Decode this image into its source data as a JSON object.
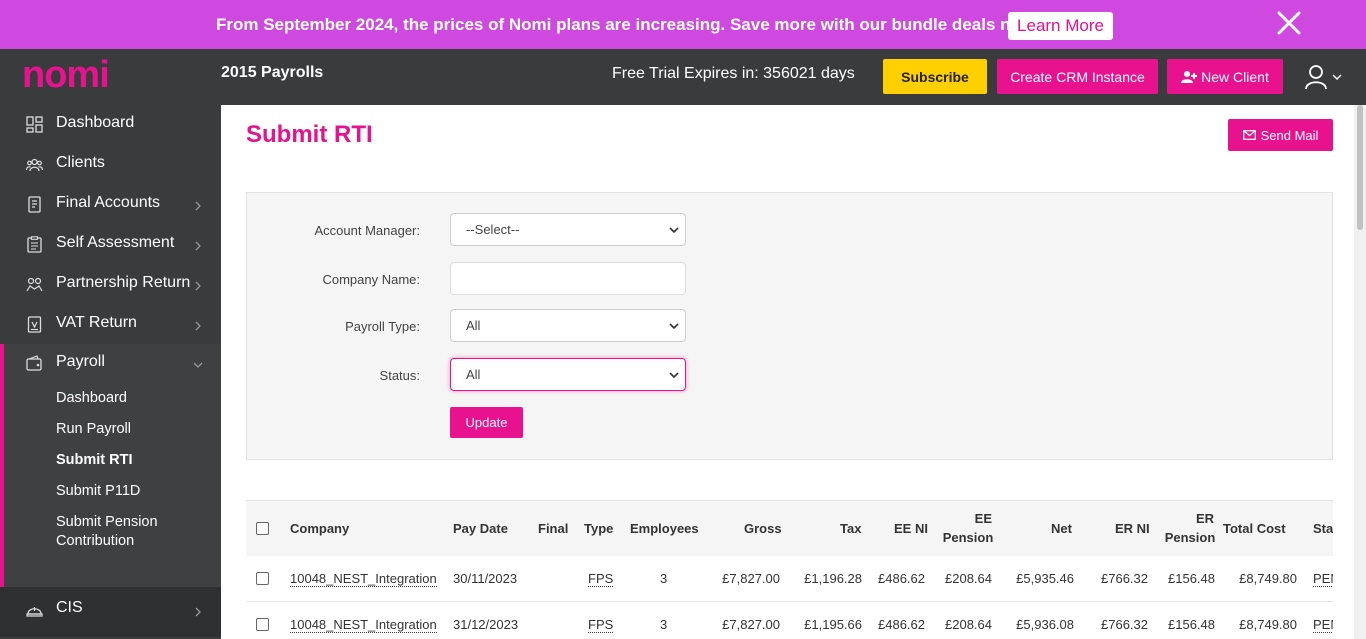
{
  "promo": {
    "text": "From September 2024, the prices of Nomi plans are increasing. Save more with our bundle deals now!",
    "button": "Learn More"
  },
  "header": {
    "logo_text": "nomi",
    "title": "2015 Payrolls",
    "trial": "Free Trial Expires in: 356021 days",
    "subscribe": "Subscribe",
    "crm": "Create CRM Instance",
    "new_client": "New Client"
  },
  "sidebar": {
    "items": [
      {
        "label": "Dashboard",
        "icon": "dashboard-icon"
      },
      {
        "label": "Clients",
        "icon": "clients-icon"
      },
      {
        "label": "Final Accounts",
        "icon": "document-icon"
      },
      {
        "label": "Self Assessment",
        "icon": "clipboard-icon"
      },
      {
        "label": "Partnership Return",
        "icon": "partnership-icon"
      },
      {
        "label": "VAT Return",
        "icon": "vat-icon"
      },
      {
        "label": "Payroll",
        "icon": "wallet-icon"
      }
    ],
    "payroll_sub": [
      "Dashboard",
      "Run Payroll",
      "Submit RTI",
      "Submit P11D",
      "Submit Pension",
      "Contribution"
    ],
    "cis": "CIS"
  },
  "main": {
    "title": "Submit RTI",
    "send_mail": "Send Mail"
  },
  "filters": {
    "account_manager_label": "Account Manager:",
    "account_manager_value": "--Select--",
    "company_name_label": "Company Name:",
    "company_name_value": "",
    "payroll_type_label": "Payroll Type:",
    "payroll_type_value": "All",
    "status_label": "Status:",
    "status_value": "All",
    "update": "Update"
  },
  "table": {
    "headers": {
      "company": "Company",
      "pay_date": "Pay Date",
      "final": "Final",
      "type": "Type",
      "employees": "Employees",
      "gross": "Gross",
      "tax": "Tax",
      "ee_ni": "EE NI",
      "ee_pension_1": "EE",
      "ee_pension_2": "Pension",
      "net": "Net",
      "er_ni": "ER NI",
      "er_pension_1": "ER",
      "er_pension_2": "Pension",
      "total_cost": "Total Cost",
      "status": "Sta"
    },
    "rows": [
      {
        "company": "10048_NEST_Integration",
        "pay_date": "30/11/2023",
        "final": "",
        "type": "FPS",
        "employees": "3",
        "gross": "£7,827.00",
        "tax": "£1,196.28",
        "ee_ni": "£486.62",
        "ee_pension": "£208.64",
        "net": "£5,935.46",
        "er_ni": "£766.32",
        "er_pension": "£156.48",
        "total_cost": "£8,749.80",
        "status": "PEN"
      },
      {
        "company": "10048_NEST_Integration",
        "pay_date": "31/12/2023",
        "final": "",
        "type": "FPS",
        "employees": "3",
        "gross": "£7,827.00",
        "tax": "£1,195.66",
        "ee_ni": "£486.62",
        "ee_pension": "£208.64",
        "net": "£5,936.08",
        "er_ni": "£766.32",
        "er_pension": "£156.48",
        "total_cost": "£8,749.80",
        "status": "PEN"
      }
    ]
  },
  "colors": {
    "accent": "#e8128e",
    "banner": "#cf48e0",
    "header": "#3a3b3d",
    "subscribe": "#ffd000"
  }
}
